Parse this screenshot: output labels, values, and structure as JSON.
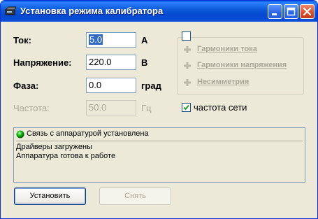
{
  "window": {
    "title": "Установка режима калибратора"
  },
  "fields": {
    "current": {
      "label": "Ток:",
      "value": "5.0",
      "unit": "А"
    },
    "voltage": {
      "label": "Напряжение:",
      "value": "220.0",
      "unit": "В"
    },
    "phase": {
      "label": "Фаза:",
      "value": "0.0",
      "unit": "град"
    },
    "frequency": {
      "label": "Частота:",
      "value": "50.0",
      "unit": "Гц"
    }
  },
  "options": {
    "group_checked": false,
    "links": [
      "Гармоники тока",
      "Гармоники напряжения",
      "Несимметрия"
    ],
    "net_frequency_label": "частота сети",
    "net_frequency_checked": true
  },
  "status": {
    "indicator_color": "#00b000",
    "header": "Связь с аппаратурой установлена",
    "messages": [
      "Драйверы загружены",
      "Аппаратура готова к работе"
    ]
  },
  "buttons": {
    "set": "Установить",
    "remove": "Снять"
  }
}
